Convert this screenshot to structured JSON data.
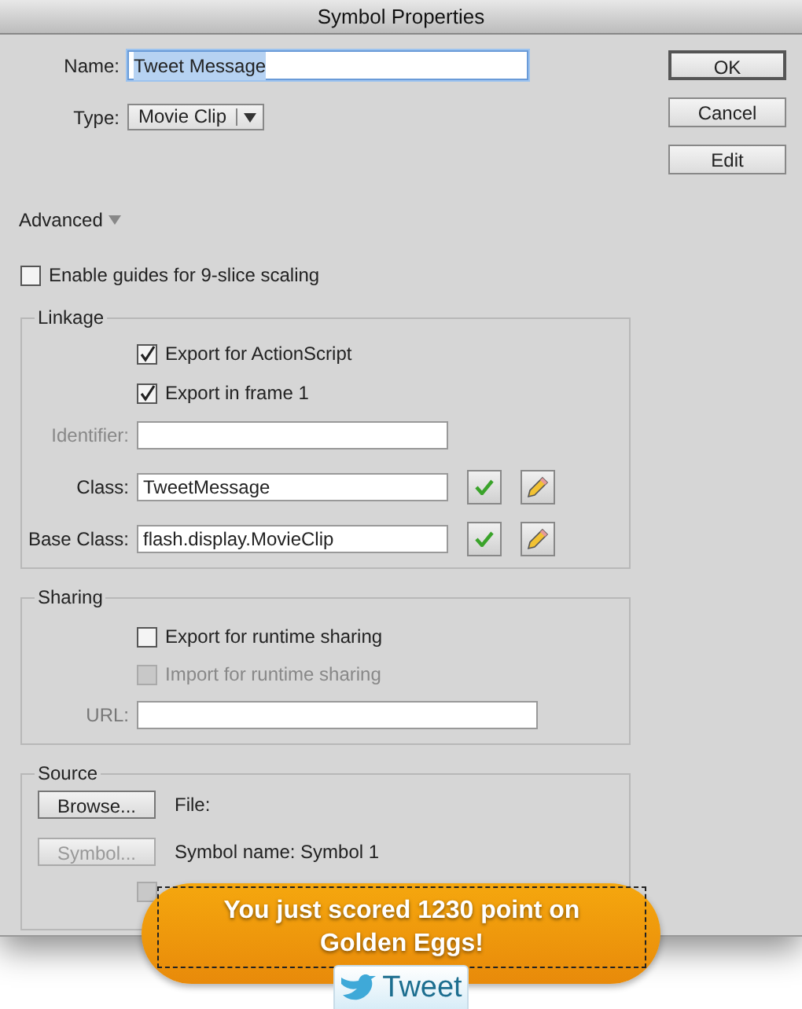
{
  "window": {
    "title": "Symbol Properties"
  },
  "name": {
    "label": "Name:",
    "value": "Tweet Message",
    "selected": true
  },
  "type": {
    "label": "Type:",
    "value": "Movie Clip"
  },
  "buttons": [
    {
      "label": "OK",
      "default": true
    },
    {
      "label": "Cancel",
      "default": false
    },
    {
      "label": "Edit",
      "default": false
    }
  ],
  "advanced": {
    "label": "Advanced",
    "expanded": true
  },
  "nine_slice": {
    "label": "Enable guides for 9-slice scaling",
    "checked": false
  },
  "linkage": {
    "title": "Linkage",
    "checkboxes": [
      {
        "label": "Export for ActionScript",
        "checked": true,
        "disabled": false
      },
      {
        "label": "Export in frame 1",
        "checked": true,
        "disabled": false
      }
    ],
    "fields": [
      {
        "label": "Identifier:",
        "disabled": true,
        "kind": "plain"
      },
      {
        "label": "Class:",
        "value": "TweetMessage",
        "disabled": false,
        "kind": "class"
      },
      {
        "label": "Base Class:",
        "value": "flash.display.MovieClip",
        "disabled": false,
        "kind": "class"
      }
    ]
  },
  "sharing": {
    "title": "Sharing",
    "checkboxes": [
      {
        "label": "Export for runtime sharing",
        "checked": false,
        "disabled": false
      },
      {
        "label": "Import for runtime sharing",
        "checked": false,
        "disabled": true
      }
    ],
    "url": {
      "label": "URL:"
    }
  },
  "source": {
    "title": "Source",
    "rows": [
      {
        "button": "Browse...",
        "disabled": false,
        "text": "File:"
      },
      {
        "button": "Symbol...",
        "disabled": true,
        "text": "Symbol name: Symbol 1"
      }
    ],
    "checkbox": {
      "checked": false,
      "disabled": true
    }
  },
  "banner": {
    "message": "You just scored 1230 point on Golden Eggs!",
    "button": "Tweet"
  }
}
